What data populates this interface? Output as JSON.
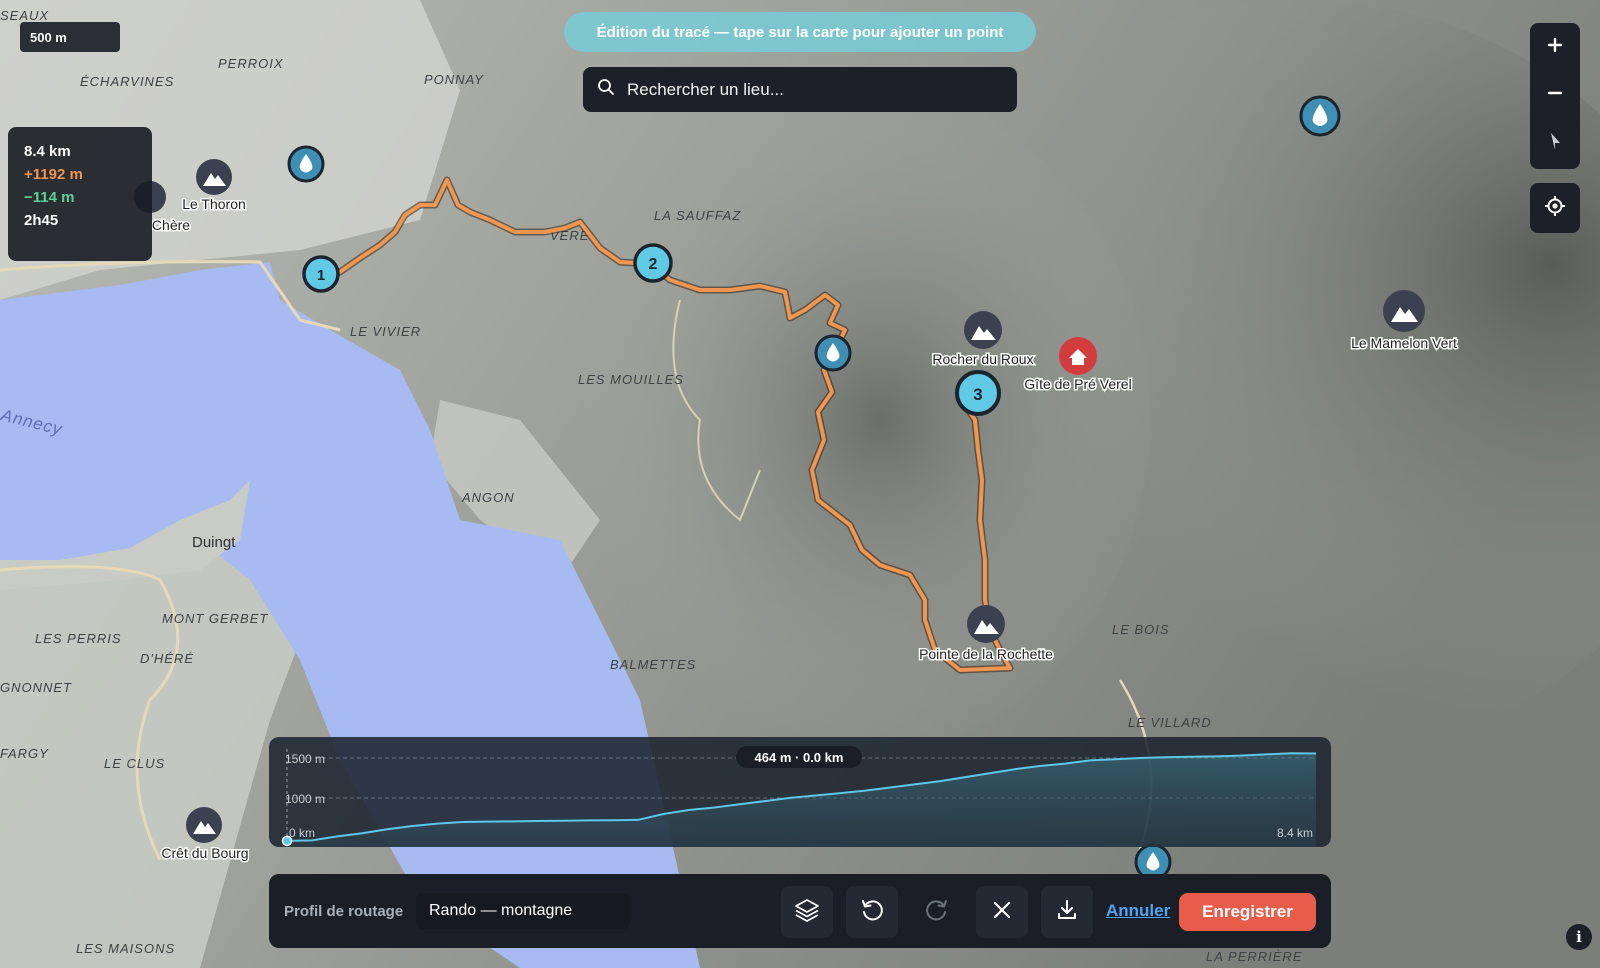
{
  "map": {
    "places": [
      "SEAUX",
      "ÉCHARVINES",
      "PERROIX",
      "PONNAY",
      "LA SAUFFAZ",
      "VERE",
      "LE VIVIER",
      "LES MOUILLES",
      "ANGON",
      "Duingt",
      "MONT GERBET",
      "LES PERRIS",
      "D'HÉRÉ",
      "GNONNET",
      "FARGY",
      "LE CLUS",
      "LES MAISONS",
      "BALMETTES",
      "LE BOIS",
      "LE VILLARD",
      "LA PERRIÈRE",
      "Annecy"
    ],
    "peaks": [
      "Le Thoron",
      "Chère",
      "Rocher du Roux",
      "Le Mamelon Vert",
      "Pointe de la Rochette",
      "Crêt du Bourg"
    ],
    "hut": "Gîte de Pré Verel",
    "waypoints": [
      "1",
      "2",
      "3"
    ],
    "route_color": "#f0964e",
    "lake_color": "#a8baf2"
  },
  "scale_label": "500 m",
  "edit_banner": "Édition du tracé — tape sur la carte pour ajouter un point",
  "search": {
    "placeholder": "Rechercher un lieu..."
  },
  "stats": {
    "distance": "8.4 km",
    "ascent": "+1192 m",
    "descent": "−114 m",
    "duration": "2h45"
  },
  "profile": {
    "labels": {
      "y_top": "1500 m",
      "y_mid": "1000 m",
      "x_start": "0 km",
      "x_end": "8.4 km"
    },
    "tooltip": "464 m · 0.0 km",
    "elevation_m": [
      464,
      470,
      520,
      560,
      610,
      650,
      680,
      700,
      705,
      708,
      712,
      715,
      720,
      722,
      728,
      800,
      850,
      880,
      920,
      960,
      1000,
      1030,
      1060,
      1090,
      1130,
      1170,
      1210,
      1260,
      1310,
      1360,
      1400,
      1430,
      1470,
      1485,
      1500,
      1510,
      1515,
      1520,
      1530,
      1545,
      1560,
      1556
    ]
  },
  "toolbar": {
    "routing_label": "Profil de routage",
    "routing_value": "Rando — montagne",
    "cancel": "Annuler",
    "save": "Enregistrer"
  },
  "icons": [
    "search-icon",
    "plus-icon",
    "minus-icon",
    "compass-icon",
    "locate-icon",
    "layers-icon",
    "undo-icon",
    "redo-icon",
    "close-icon",
    "download-icon",
    "info-icon",
    "water-icon",
    "peak-icon",
    "hut-icon"
  ]
}
